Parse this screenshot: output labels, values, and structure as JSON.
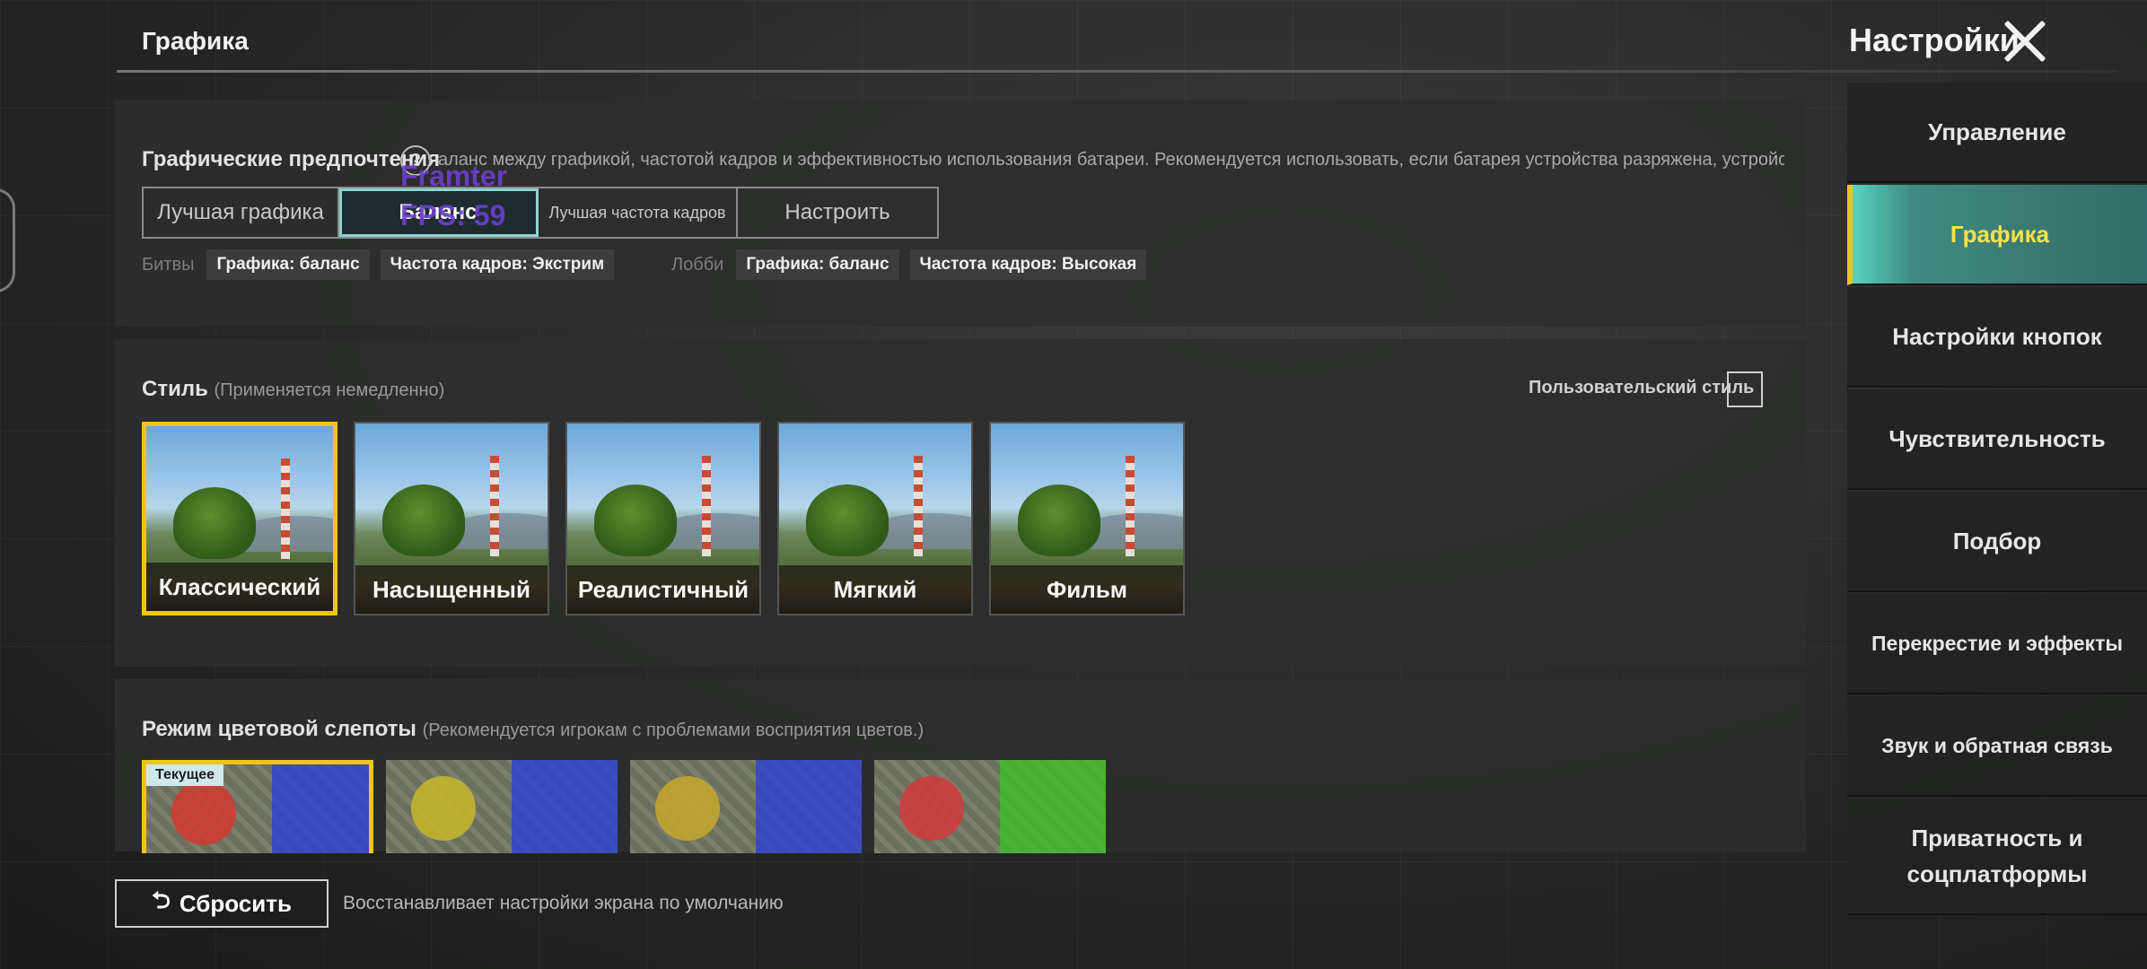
{
  "header": {
    "section_title": "Графика",
    "settings_title": "Настройки"
  },
  "preferences": {
    "label": "Графические предпочтения",
    "help": "?",
    "description": "аланс между графикой, частотой кадров и эффективностью использования батареи. Рекомендуется использовать, если батарея устройства разряжена, устройство нахо",
    "options": [
      "Лучшая графика",
      "Баланс",
      "Лучшая частота кадров",
      "Настроить"
    ],
    "selected": "Баланс",
    "overlay_text": "Framter\nFPS: 59",
    "battles_label": "Битвы",
    "battles_chips": [
      "Графика: баланс",
      "Частота кадров: Экстрим"
    ],
    "lobby_label": "Лобби",
    "lobby_chips": [
      "Графика: баланс",
      "Частота кадров: Высокая"
    ]
  },
  "style": {
    "label": "Стиль",
    "note": "(Применяется немедленно)",
    "custom_label": "Пользовательский стиль",
    "options": [
      "Классический",
      "Насыщенный",
      "Реалистичный",
      "Мягкий",
      "Фильм"
    ],
    "selected": "Классический"
  },
  "colorblind": {
    "label": "Режим цветовой слепоты",
    "note": "(Рекомендуется игрокам с проблемами восприятия цветов.)",
    "current_tag": "Текущее",
    "tiles": [
      {
        "blob_color": "#d23a2f",
        "zone_color": "#2b3fd6"
      },
      {
        "blob_color": "#c8b82a",
        "zone_color": "#2b3fd6"
      },
      {
        "blob_color": "#c8a82a",
        "zone_color": "#2b3fd6"
      },
      {
        "blob_color": "#d23a3a",
        "zone_color": "#3fbf2a"
      }
    ]
  },
  "reset": {
    "label": "Сбросить",
    "description": "Восстанавливает настройки экрана по умолчанию"
  },
  "sidebar": {
    "items": [
      {
        "label": "Управление"
      },
      {
        "label": "Графика"
      },
      {
        "label": "Настройки кнопок"
      },
      {
        "label": "Чувствительность"
      },
      {
        "label": "Подбор"
      },
      {
        "label": "Перекрестие и эффекты"
      },
      {
        "label": "Звук и обратная связь"
      },
      {
        "label": "Приватность и соцплатформы"
      }
    ],
    "active": "Графика"
  },
  "colors": {
    "accent_yellow": "#f0c419",
    "accent_teal": "#8fd3d0"
  }
}
